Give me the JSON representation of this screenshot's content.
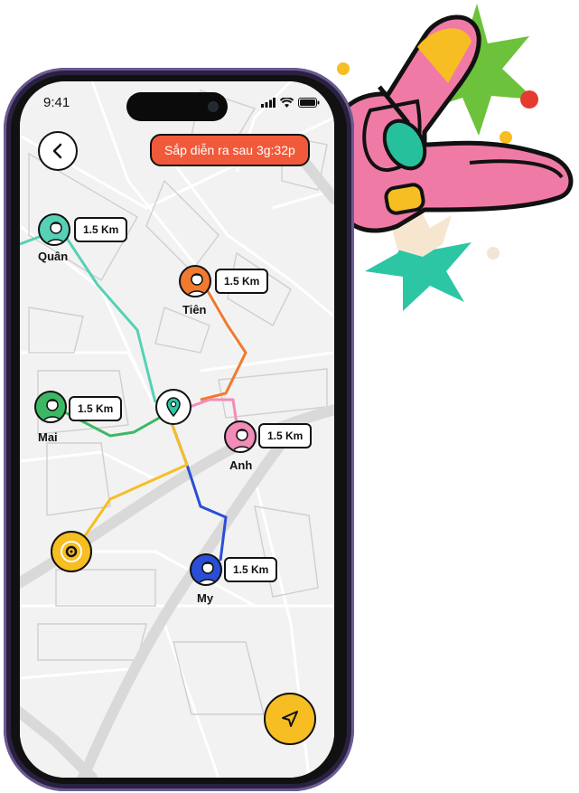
{
  "status_bar": {
    "time": "9:41"
  },
  "header": {
    "countdown_label": "Sắp diễn ra sau 3g:32p"
  },
  "friends": [
    {
      "name": "Quân",
      "distance": "1.5 Km",
      "color": "#57d1b6"
    },
    {
      "name": "Tiên",
      "distance": "1.5 Km",
      "color": "#f07a30"
    },
    {
      "name": "Mai",
      "distance": "1.5 Km",
      "color": "#3cb864"
    },
    {
      "name": "Anh",
      "distance": "1.5 Km",
      "color": "#f28cb8"
    },
    {
      "name": "My",
      "distance": "1.5 Km",
      "color": "#2a4fd6"
    }
  ],
  "icons": {
    "back": "chevron-left-icon",
    "destination": "location-pin-icon",
    "origin": "target-icon",
    "navigate": "navigation-arrow-icon"
  },
  "colors": {
    "accent_orange": "#f05a3a",
    "accent_yellow": "#f6be22",
    "route_yellow": "#f6be22",
    "map_background": "#f2f2f2"
  }
}
